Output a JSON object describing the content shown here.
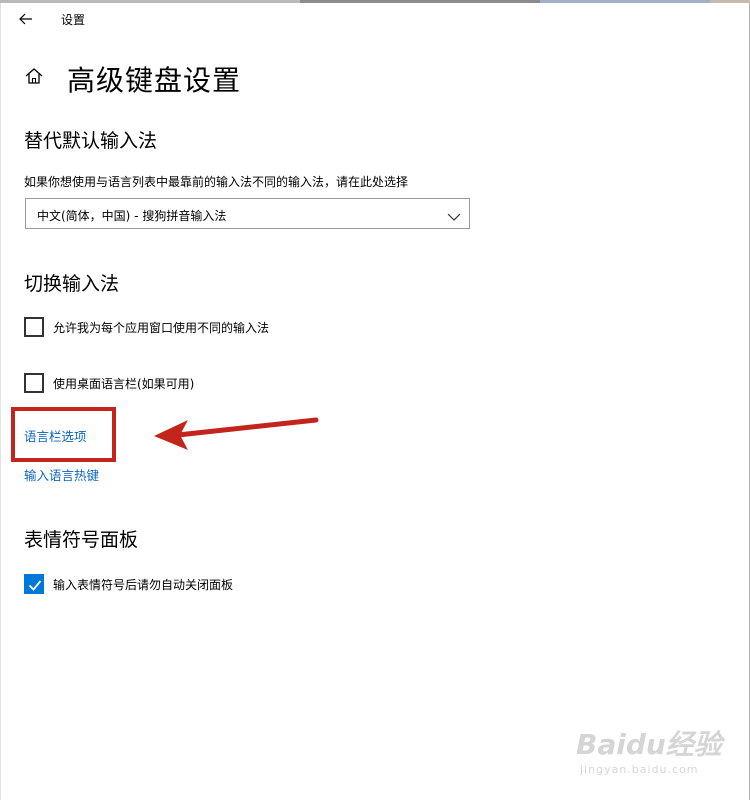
{
  "window": {
    "title": "设置"
  },
  "page": {
    "title": "高级键盘设置"
  },
  "override": {
    "heading": "替代默认输入法",
    "description": "如果你想使用与语言列表中最靠前的输入法不同的输入法，请在此处选择",
    "dropdown_value": "中文(简体，中国) - 搜狗拼音输入法"
  },
  "switch": {
    "heading": "切换输入法",
    "options": [
      {
        "label": "允许我为每个应用窗口使用不同的输入法",
        "checked": false
      },
      {
        "label": "使用桌面语言栏(如果可用)",
        "checked": false
      }
    ],
    "links": {
      "language_bar_options": "语言栏选项",
      "input_hotkeys": "输入语言热键"
    }
  },
  "emoji": {
    "heading": "表情符号面板",
    "option": {
      "label": "输入表情符号后请勿自动关闭面板",
      "checked": true
    }
  },
  "colors": {
    "accent": "#0078d7",
    "link": "#0a66c2",
    "annotation_red": "#c3251c"
  },
  "watermark": {
    "brand": "Baidu经验",
    "url": "jingyan.baidu.com"
  }
}
